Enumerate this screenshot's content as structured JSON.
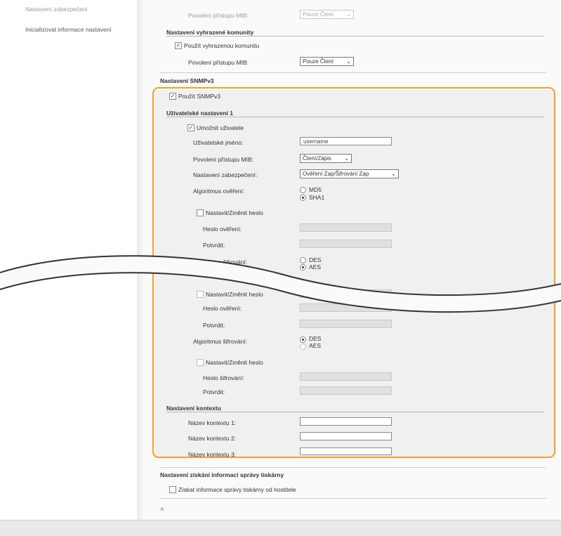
{
  "sidebar": {
    "items": [
      {
        "label": "Nastavení zabezpečení"
      },
      {
        "label": "Inicializovat informace nastavení"
      }
    ]
  },
  "top": {
    "mib_label": "Povolení přístupu MIB:",
    "mib_value": "Pouze Čtení"
  },
  "dedicated": {
    "title": "Nastavení vyhrazené komunity",
    "use_label": "Použít vyhrazenou komunitu",
    "mib_label": "Povolení přístupu MIB:",
    "mib_value": "Pouze Čtení"
  },
  "snmpv3": {
    "title": "Nastavení SNMPv3",
    "use_label": "Použít SNMPv3",
    "user1": {
      "title": "Uživatelské nastavení 1",
      "enable_label": "Umožnit uživatele",
      "username_label": "Uživatelské jméno:",
      "username_value": "username",
      "mib_label": "Povolení přístupu MIB:",
      "mib_value": "Čtení/Zápis",
      "security_label": "Nastavení zabezpečení:",
      "security_value": "Ověření Zap/Šifrování Zap",
      "auth_algo_label": "Algoritmus ověření:",
      "auth_options": [
        "MD5",
        "SHA1"
      ],
      "set_pw_label": "Nastavit/Změnit heslo",
      "auth_pw_label": "Heslo ověření:",
      "confirm_label": "Potvrdit:",
      "enc_algo_label": "Algoritmus šifrování:",
      "enc_options": [
        "DES",
        "AES"
      ]
    },
    "lower": {
      "set_pw_label": "Nastavit/Změnit heslo",
      "auth_pw_label": "Heslo ověření:",
      "confirm_label": "Potvrdit:",
      "enc_algo_label": "Algoritmus šifrování:",
      "enc_options": [
        "DES",
        "AES"
      ],
      "set_pw2_label": "Nastavit/Změnit heslo",
      "enc_pw_label": "Heslo šifrování:",
      "confirm2_label": "Potvrdit:"
    },
    "context": {
      "title": "Nastavení kontextu",
      "names": [
        "Název kontextu 1:",
        "Název kontextu 2:",
        "Název kontextu 3:"
      ]
    }
  },
  "printer_mgmt": {
    "title": "Nastavení získání informací správy tiskárny",
    "get_label": "Získat informace správy tiskárny od hostitele"
  },
  "nav": {
    "top_glyph": "⩡"
  },
  "colors": {
    "highlight": "#f1a22a"
  }
}
